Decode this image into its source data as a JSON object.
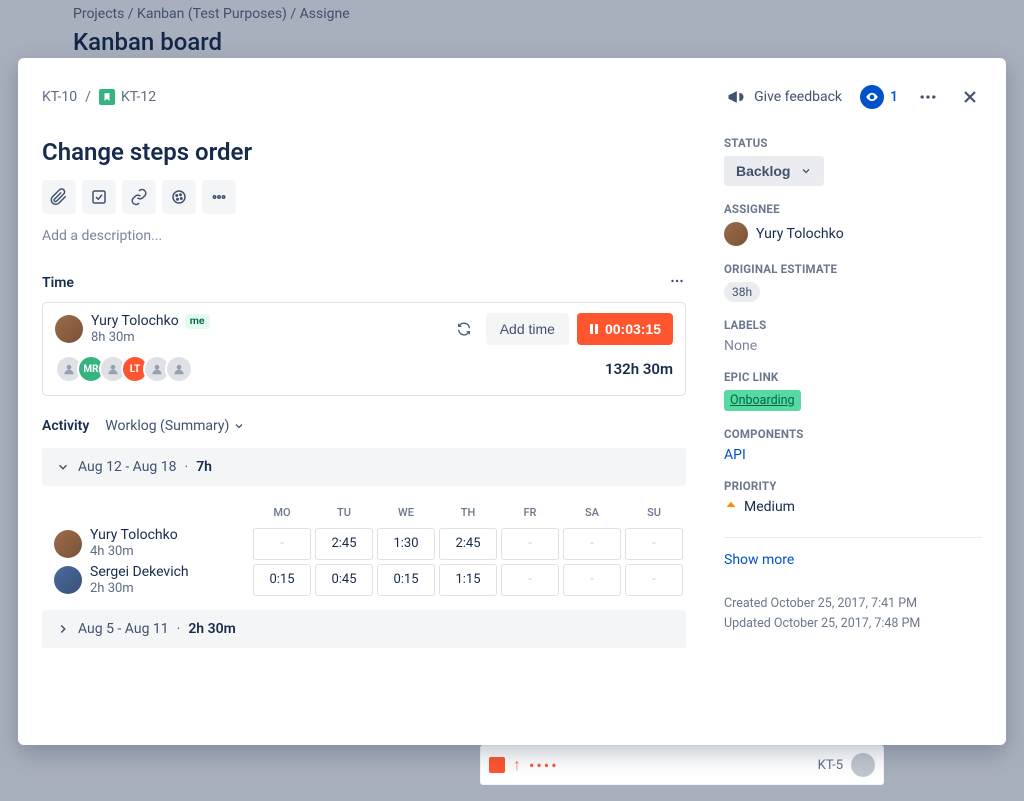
{
  "backdrop": {
    "crumbs": "Projects  /  Kanban (Test Purposes)  /  Assigne",
    "board_title": "Kanban board",
    "bottom_id": "KT-5"
  },
  "header": {
    "parent_key": "KT-10",
    "issue_key": "KT-12",
    "feedback_label": "Give feedback",
    "watch_count": "1"
  },
  "issue": {
    "title": "Change steps order",
    "desc_placeholder": "Add a description..."
  },
  "time": {
    "section_title": "Time",
    "current_user": "Yury Tolochko",
    "me_badge": "me",
    "current_user_time": "8h 30m",
    "add_time_label": "Add time",
    "timer_value": "00:03:15",
    "stack": [
      "",
      "MR",
      "",
      "LT",
      "",
      ""
    ],
    "total": "132h 30m"
  },
  "activity": {
    "title": "Activity",
    "view_label": "Worklog (Summary)",
    "weeks": [
      {
        "expanded": true,
        "range": "Aug 12 - Aug 18",
        "hours": "7h",
        "days": [
          "MO",
          "TU",
          "WE",
          "TH",
          "FR",
          "SA",
          "SU"
        ],
        "rows": [
          {
            "name": "Yury Tolochko",
            "dur": "4h 30m",
            "cells": [
              "-",
              "2:45",
              "1:30",
              "2:45",
              "-",
              "-",
              "-"
            ]
          },
          {
            "name": "Sergei Dekevich",
            "dur": "2h 30m",
            "cells": [
              "0:15",
              "0:45",
              "0:15",
              "1:15",
              "-",
              "-",
              "-"
            ]
          }
        ]
      },
      {
        "expanded": false,
        "range": "Aug 5 - Aug 11",
        "hours": "2h 30m"
      }
    ]
  },
  "side": {
    "status_label": "STATUS",
    "status_value": "Backlog",
    "assignee_label": "ASSIGNEE",
    "assignee_name": "Yury Tolochko",
    "estimate_label": "ORIGINAL ESTIMATE",
    "estimate_value": "38h",
    "labels_label": "LABELS",
    "labels_value": "None",
    "epic_label": "EPIC LINK",
    "epic_value": "Onboarding",
    "components_label": "COMPONENTS",
    "components_value": "API",
    "priority_label": "PRIORITY",
    "priority_value": "Medium",
    "show_more": "Show more",
    "created": "Created October 25, 2017, 7:41 PM",
    "updated": "Updated October 25, 2017, 7:48 PM"
  }
}
